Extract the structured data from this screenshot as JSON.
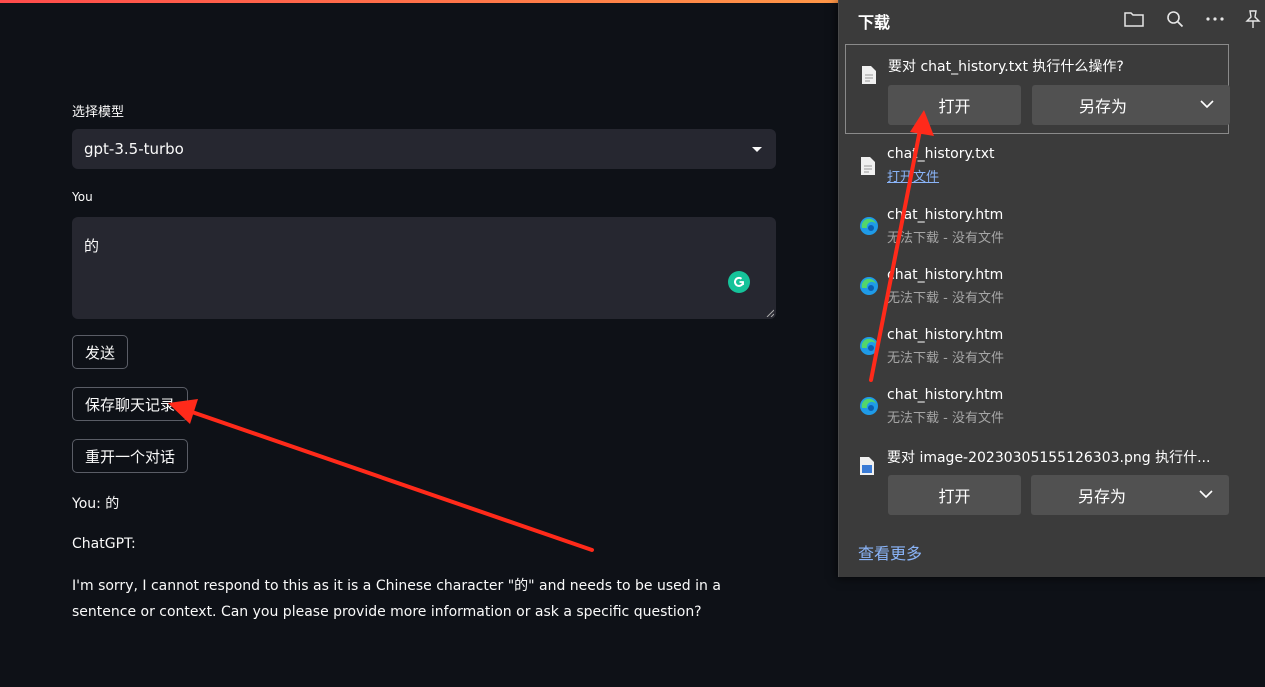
{
  "app": {
    "model_label": "选择模型",
    "model_value": "gpt-3.5-turbo",
    "you_label": "You",
    "input_value": "的",
    "send_label": "发送",
    "save_label": "保存聊天记录",
    "restart_label": "重开一个对话",
    "you_line": "You: 的",
    "chatgpt_label": "ChatGPT:",
    "answer": "I'm sorry, I cannot respond to this as it is a Chinese character \"的\" and needs to be used in a sentence or context. Can you please provide more information or ask a specific question?"
  },
  "downloads": {
    "title": "下载",
    "prompt_item": {
      "text": "要对 chat_history.txt 执行什么操作?",
      "open": "打开",
      "save_as": "另存为"
    },
    "items": [
      {
        "name": "chat_history.txt",
        "sub": "打开文件"
      },
      {
        "name": "chat_history.htm",
        "sub": "无法下载 - 没有文件"
      },
      {
        "name": "chat_history.htm",
        "sub": "无法下载 - 没有文件"
      },
      {
        "name": "chat_history.htm",
        "sub": "无法下载 - 没有文件"
      },
      {
        "name": "chat_history.htm",
        "sub": "无法下载 - 没有文件"
      }
    ],
    "image_item": {
      "text": "要对 image-20230305155126303.png 执行什...",
      "open": "打开",
      "save_as": "另存为"
    },
    "see_more": "查看更多"
  },
  "colors": {
    "background": "#0e1117",
    "panel": "#3b3b3b",
    "link": "#8ab4f8",
    "arrow": "#ff2a1a"
  }
}
